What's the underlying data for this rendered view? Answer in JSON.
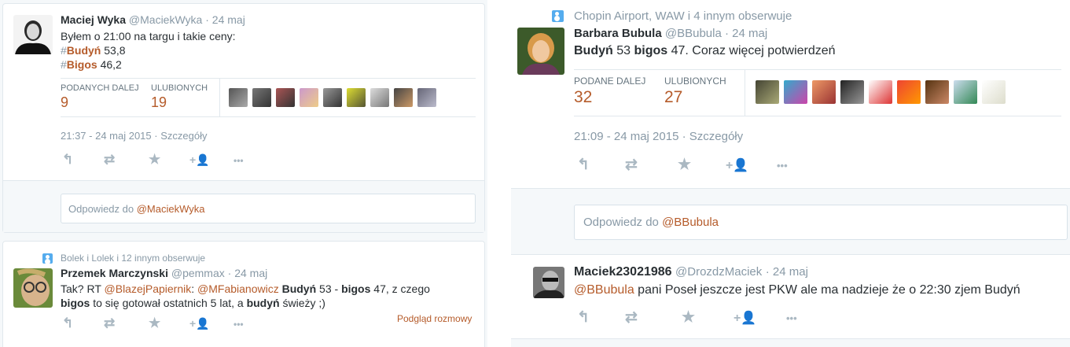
{
  "left": {
    "tweet1": {
      "name": "Maciej Wyka",
      "handle": "@MaciekWyka",
      "date": "· 24 maj",
      "line1": "Byłem o 21:00 na targu i takie ceny:",
      "line2_hash": "#",
      "line2_tag": "Budyń",
      "line2_val": " 53,8",
      "line3_hash": "#",
      "line3_tag": "Bigos",
      "line3_val": " 46,2",
      "retweets_label": "PODANYCH DALEJ",
      "retweets": "9",
      "favs_label": "ULUBIONYCH",
      "favs": "19",
      "timestamp": "21:37 - 24 maj 2015",
      "details": "· Szczegóły",
      "reply_prefix": "Odpowiedz do ",
      "reply_mention": "@MaciekWyka"
    },
    "tweet2": {
      "context": "Bolek i Lolek i 12 innym obserwuje",
      "name": "Przemek Marczynski",
      "handle": "@pemmax",
      "date": "· 24 maj",
      "t1": "Tak? RT ",
      "m1": "@BlazejPapiernik",
      "t2": ": ",
      "m2": "@MFabianowicz",
      "t3": " ",
      "b1": "Budyń",
      "t4": " 53 - ",
      "b2": "bigos",
      "t5": " 47, z czego",
      "b3": "bigos",
      "t6": " to się gotował ostatnich 5 lat, a ",
      "b4": "budyń",
      "t7": " świeży ;)",
      "conversation": "Podgląd rozmowy"
    }
  },
  "right": {
    "tweet1": {
      "context": "Chopin Airport, WAW i 4 innym obserwuje",
      "name": "Barbara Bubula",
      "handle": "@BBubula",
      "date": "· 24 maj",
      "b1": "Budyń",
      "t1": " 53 ",
      "b2": "bigos",
      "t2": " 47. Coraz więcej potwierdzeń",
      "retweets_label": "PODANE DALEJ",
      "retweets": "32",
      "favs_label": "ULUBIONYCH",
      "favs": "27",
      "timestamp": "21:09 - 24 maj 2015",
      "details": "· Szczegóły",
      "reply_prefix": "Odpowiedz do ",
      "reply_mention": "@BBubula"
    },
    "tweet2": {
      "name": "Maciek23021986",
      "handle": "@DrozdzMaciek",
      "date": "· 24 maj",
      "mention": "@BBubula",
      "text": " pani Poseł jeszcze jest PKW ale ma nadzieje że o 22:30 zjem Budyń"
    }
  },
  "icons": {
    "reply": "↰",
    "retweet": "⇄",
    "favorite": "★",
    "follow": "+👤",
    "more": "•••"
  },
  "colors": {
    "accent": "#b55b2a",
    "muted": "#8899a6",
    "border": "#e1e8ed"
  }
}
